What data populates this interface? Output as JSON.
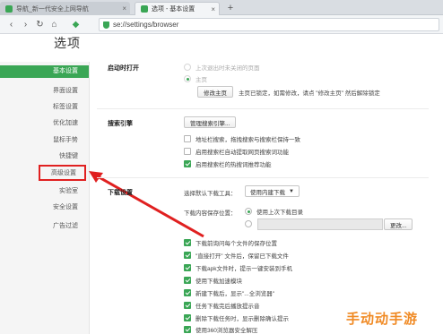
{
  "tabs": [
    {
      "title": "导航_新一代安全上网导航",
      "active": false
    },
    {
      "title": "选项 - 基本设置",
      "active": true
    }
  ],
  "new_tab_label": "+",
  "address": {
    "url": "se://settings/browser"
  },
  "page_title": "选项",
  "sidebar": {
    "items": [
      {
        "label": "基本设置",
        "active": true
      },
      {
        "label": "界面设置",
        "active": false
      },
      {
        "label": "标签设置",
        "active": false
      },
      {
        "label": "优化加速",
        "active": false
      },
      {
        "label": "鼠标手势",
        "active": false
      },
      {
        "label": "快捷键",
        "active": false
      },
      {
        "label": "高级设置",
        "active": false
      },
      {
        "label": "实验室",
        "active": false
      },
      {
        "label": "安全设置",
        "active": false
      },
      {
        "label": "广告过滤",
        "active": false
      }
    ]
  },
  "startup": {
    "label": "启动时打开",
    "option_last": "上次退出时未关闭的页面",
    "option_home": "主页",
    "modify_home_button": "修改主页",
    "home_locked_note": "主页已锁定，如需修改，请点 \"修改主页\" 然后解除锁定"
  },
  "search": {
    "label": "搜索引擎",
    "manage_button": "管理搜索引擎...",
    "options": [
      {
        "text": "地址栏搜索，拖拽搜索与搜索栏保持一致",
        "checked": false
      },
      {
        "text": "启用搜索栏自动提取网页搜索词功能",
        "checked": false
      },
      {
        "text": "启用搜索栏的热搜词推荐功能",
        "checked": true
      }
    ]
  },
  "download": {
    "label": "下载设置",
    "tool_label": "选择默认下载工具：",
    "tool_value": "使用内建下载",
    "location_label": "下载内容保存位置：",
    "location_last": "使用上次下载目录",
    "change_button": "更改...",
    "options": [
      {
        "text": "下载前询问每个文件的保存位置",
        "checked": true
      },
      {
        "text": "\"直接打开\" 文件后，保留已下载文件",
        "checked": true
      },
      {
        "text": "下载apk文件时，提示一键安装到手机",
        "checked": true
      },
      {
        "text": "使用下载加速模块",
        "checked": true
      },
      {
        "text": "新建下载后，显示\"...全浏览器\"",
        "checked": true
      },
      {
        "text": "任务下载完后播放提示音",
        "checked": true
      },
      {
        "text": "删除下载任务时，显示删除确认提示",
        "checked": true
      },
      {
        "text": "使用360浏览器安全解压",
        "checked": true
      }
    ]
  },
  "watermark": "手动动手游",
  "colors": {
    "accent": "#3aa655",
    "highlight": "#e02020",
    "watermark": "#f08a24"
  }
}
